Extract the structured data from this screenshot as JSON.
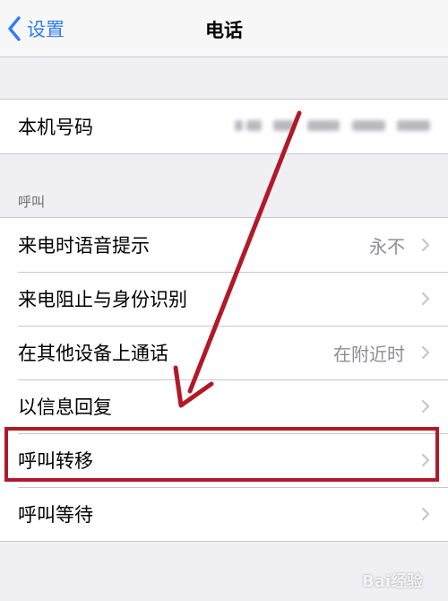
{
  "navbar": {
    "back_label": "设置",
    "title": "电话"
  },
  "my_number": {
    "label": "本机号码"
  },
  "calls_section": {
    "header": "呼叫",
    "items": [
      {
        "label": "来电时语音提示",
        "value": "永不"
      },
      {
        "label": "来电阻止与身份识别",
        "value": ""
      },
      {
        "label": "在其他设备上通话",
        "value": "在附近时"
      },
      {
        "label": "以信息回复",
        "value": ""
      },
      {
        "label": "呼叫转移",
        "value": ""
      },
      {
        "label": "呼叫等待",
        "value": ""
      }
    ]
  },
  "colors": {
    "accent": "#2f7cf6",
    "annotation": "#b01a28"
  },
  "watermark": "Bai经验"
}
